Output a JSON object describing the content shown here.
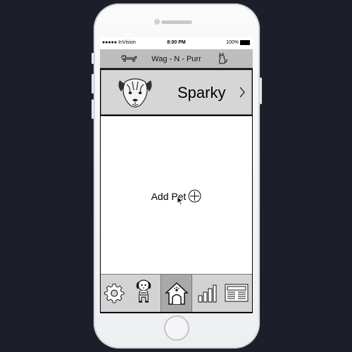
{
  "status_bar": {
    "carrier": "●●●●● InVision",
    "time": "8:00 PM",
    "battery": "100%"
  },
  "nav": {
    "title": "Wag - N - Purr",
    "left_icon": "dachshund-icon",
    "right_icon": "cat-icon"
  },
  "pet_card": {
    "name": "Sparky",
    "avatar_icon": "dog-face-icon",
    "chevron_icon": "chevron-right-icon"
  },
  "main": {
    "add_pet_label": "Add Pet",
    "add_icon": "plus-circle-icon"
  },
  "tab_bar": {
    "tabs": [
      {
        "name": "settings",
        "icon": "gear-icon"
      },
      {
        "name": "pet-profile",
        "icon": "dog-icon"
      },
      {
        "name": "home",
        "icon": "doghouse-icon",
        "active": true
      },
      {
        "name": "stats",
        "icon": "bar-chart-icon"
      },
      {
        "name": "news",
        "icon": "newspaper-icon"
      }
    ]
  },
  "colors": {
    "page_background": "#1c1f29",
    "nav_background": "#bdbdbd",
    "card_background": "#d6d6d6",
    "tab_bar_background": "#d3d3d3",
    "active_tab_background": "#a9a9a9"
  }
}
